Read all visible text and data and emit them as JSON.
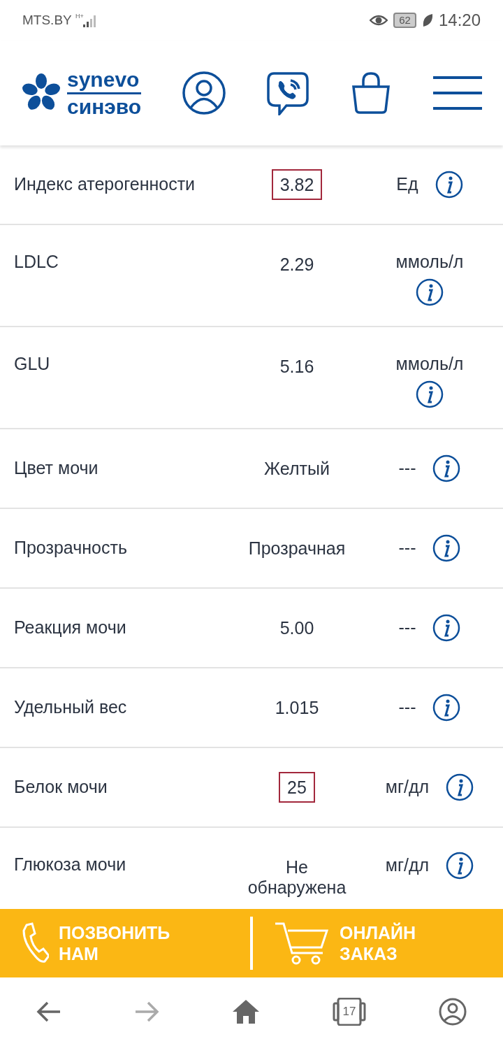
{
  "status_bar": {
    "carrier": "MTS.BY",
    "network": "H+",
    "battery": "62",
    "time": "14:20"
  },
  "logo": {
    "line_1": "synevo",
    "line_2": "синэво"
  },
  "rows": [
    {
      "name": "Индекс атерогенности",
      "value": "3.82",
      "flagged": true,
      "unit": "Ед"
    },
    {
      "name": "LDLC",
      "value": "2.29",
      "flagged": false,
      "unit": "ммоль/л"
    },
    {
      "name": "GLU",
      "value": "5.16",
      "flagged": false,
      "unit": "ммоль/л"
    },
    {
      "name": "Цвет мочи",
      "value": "Желтый",
      "flagged": false,
      "unit": "---"
    },
    {
      "name": "Прозрачность",
      "value": "Прозрачная",
      "flagged": false,
      "unit": "---"
    },
    {
      "name": "Реакция мочи",
      "value": "5.00",
      "flagged": false,
      "unit": "---"
    },
    {
      "name": "Удельный вес",
      "value": "1.015",
      "flagged": false,
      "unit": "---"
    },
    {
      "name": "Белок мочи",
      "value": "25",
      "flagged": true,
      "unit": "мг/дл"
    },
    {
      "name": "Глюкоза мочи",
      "value": "Не обнаружена",
      "flagged": false,
      "unit": "мг/дл"
    }
  ],
  "action_bar": [
    {
      "kind": "call",
      "label": "ПОЗВОНИТЬ НАМ"
    },
    {
      "kind": "order",
      "label": "ОНЛАЙН ЗАКАЗ"
    }
  ],
  "nav": {
    "back_enabled": true,
    "forward_enabled": false,
    "tabs_count": "17"
  }
}
